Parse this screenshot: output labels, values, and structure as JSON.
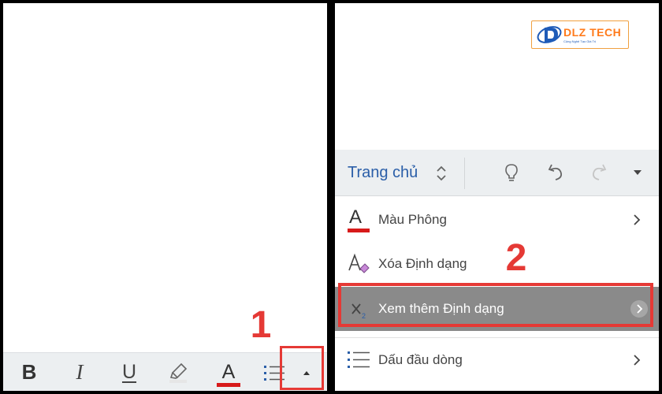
{
  "left": {
    "toolbar": {
      "bold": "B",
      "italic": "I",
      "underline": "U",
      "font_color": "A",
      "font_color_bar": "#d71a1a"
    },
    "step": "1"
  },
  "right": {
    "logo": {
      "brand": "DLZ TECH",
      "tagline": "Cộng Nghệ Tạo Giá Trị"
    },
    "ribbon": {
      "title": "Trang chủ"
    },
    "menu": {
      "font_color": "Màu Phông",
      "clear_format": "Xóa Định dạng",
      "more_format": "Xem thêm Định dạng",
      "bullets": "Dấu đầu dòng"
    },
    "step": "2"
  },
  "colors": {
    "accent_blue": "#2a5ea8",
    "highlight_red": "#e53935",
    "toolbar_bg": "#eceff1",
    "selected_row": "#8a8a8a"
  }
}
